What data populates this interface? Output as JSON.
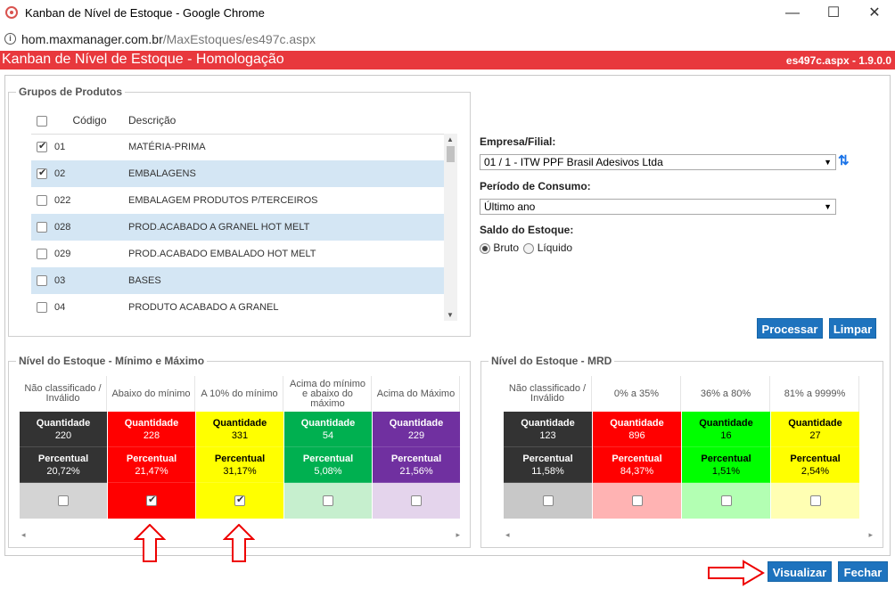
{
  "window": {
    "title": "Kanban de Nível de Estoque - Google Chrome",
    "minimize": "—",
    "maximize": "☐",
    "close": "✕"
  },
  "browser": {
    "url_host": "hom.maxmanager.com.br",
    "url_path": "/MaxEstoques/es497c.aspx"
  },
  "header": {
    "title": "Kanban de Nível de Estoque - Homologação",
    "version": "es497c.aspx - 1.9.0.0",
    "color": "#e8383d"
  },
  "grupos": {
    "legend": "Grupos de Produtos",
    "col_codigo": "Código",
    "col_descricao": "Descrição",
    "rows": [
      {
        "code": "01",
        "desc": "MATÉRIA-PRIMA",
        "checked": true
      },
      {
        "code": "02",
        "desc": "EMBALAGENS",
        "checked": true
      },
      {
        "code": "022",
        "desc": "EMBALAGEM PRODUTOS P/TERCEIROS",
        "checked": false
      },
      {
        "code": "028",
        "desc": "PROD.ACABADO A GRANEL HOT MELT",
        "checked": false
      },
      {
        "code": "029",
        "desc": "PROD.ACABADO EMBALADO HOT MELT",
        "checked": false
      },
      {
        "code": "03",
        "desc": "BASES",
        "checked": false
      },
      {
        "code": "04",
        "desc": "PRODUTO ACABADO A GRANEL",
        "checked": false
      }
    ]
  },
  "filters": {
    "empresa_label": "Empresa/Filial:",
    "empresa_value": "01 / 1 - ITW PPF Brasil Adesivos Ltda",
    "periodo_label": "Período de Consumo:",
    "periodo_value": "Último ano",
    "saldo_label": "Saldo do Estoque:",
    "saldo_bruto": "Bruto",
    "saldo_liquido": "Líquido",
    "saldo_selected": "Bruto",
    "processar": "Processar",
    "limpar": "Limpar"
  },
  "minmax": {
    "legend": "Nível do Estoque - Mínimo e Máximo",
    "columns": [
      {
        "header": "Não classificado / Inválido",
        "qty_label": "Quantidade",
        "qty": "220",
        "pct_label": "Percentual",
        "pct": "20,72%",
        "color": "#333333",
        "check_bg": "#d4d4d4",
        "text_color": "#ffffff",
        "checked": false
      },
      {
        "header": "Abaixo do mínimo",
        "qty_label": "Quantidade",
        "qty": "228",
        "pct_label": "Percentual",
        "pct": "21,47%",
        "color": "#ff0000",
        "check_bg": "#ff0000",
        "text_color": "#ffffff",
        "checked": true
      },
      {
        "header": "A 10% do mínimo",
        "qty_label": "Quantidade",
        "qty": "331",
        "pct_label": "Percentual",
        "pct": "31,17%",
        "color": "#ffff00",
        "check_bg": "#ffff00",
        "text_color": "#000000",
        "checked": true
      },
      {
        "header": "Acima do mínimo e abaixo do máximo",
        "qty_label": "Quantidade",
        "qty": "54",
        "pct_label": "Percentual",
        "pct": "5,08%",
        "color": "#00b050",
        "check_bg": "#c6efce",
        "text_color": "#ffffff",
        "checked": false
      },
      {
        "header": "Acima do Máximo",
        "qty_label": "Quantidade",
        "qty": "229",
        "pct_label": "Percentual",
        "pct": "21,56%",
        "color": "#7030a0",
        "check_bg": "#e4d4ec",
        "text_color": "#ffffff",
        "checked": false
      }
    ]
  },
  "mrd": {
    "legend": "Nível do Estoque - MRD",
    "columns": [
      {
        "header": "Não classificado / Inválido",
        "qty_label": "Quantidade",
        "qty": "123",
        "pct_label": "Percentual",
        "pct": "11,58%",
        "color": "#333333",
        "check_bg": "#c8c8c8",
        "text_color": "#ffffff",
        "checked": false
      },
      {
        "header": "0% a 35%",
        "qty_label": "Quantidade",
        "qty": "896",
        "pct_label": "Percentual",
        "pct": "84,37%",
        "color": "#ff0000",
        "check_bg": "#ffb3b3",
        "text_color": "#ffffff",
        "checked": false
      },
      {
        "header": "36% a 80%",
        "qty_label": "Quantidade",
        "qty": "16",
        "pct_label": "Percentual",
        "pct": "1,51%",
        "color": "#00ff00",
        "check_bg": "#b3ffb3",
        "text_color": "#000000",
        "checked": false
      },
      {
        "header": "81% a 9999%",
        "qty_label": "Quantidade",
        "qty": "27",
        "pct_label": "Percentual",
        "pct": "2,54%",
        "color": "#ffff00",
        "check_bg": "#ffffb3",
        "text_color": "#000000",
        "checked": false
      }
    ]
  },
  "footer": {
    "visualizar": "Visualizar",
    "fechar": "Fechar"
  }
}
